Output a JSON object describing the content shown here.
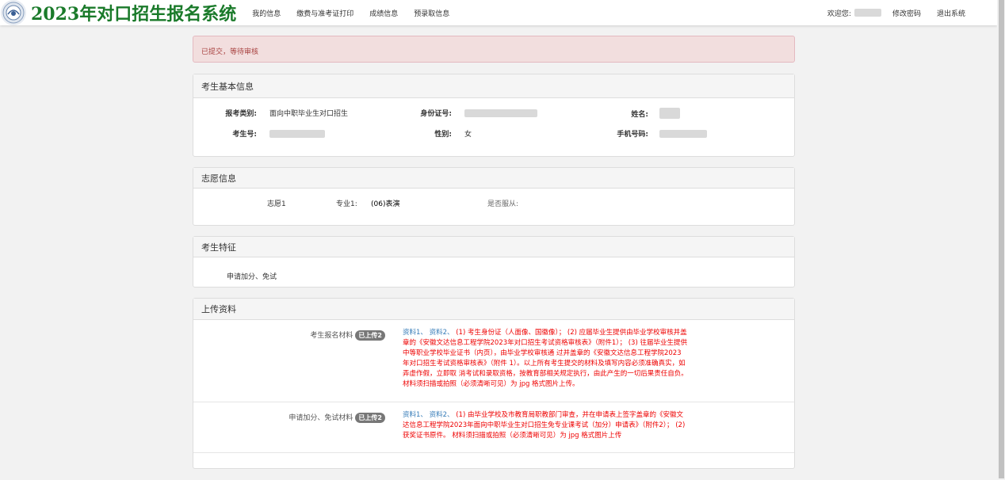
{
  "header": {
    "system_title": "2023年对口招生报名系统",
    "nav": [
      "我的信息",
      "缴费与准考证打印",
      "成绩信息",
      "预录取信息"
    ],
    "welcome": "欢迎您:",
    "change_password": "修改密码",
    "logout": "退出系统"
  },
  "alert": {
    "message": "已提交，等待审核"
  },
  "basic_info": {
    "title": "考生基本信息",
    "category_label": "报考类别:",
    "category_value": "面向中职毕业生对口招生",
    "id_label": "身份证号:",
    "name_label": "姓名:",
    "exam_no_label": "考生号:",
    "gender_label": "性别:",
    "gender_value": "女",
    "phone_label": "手机号码:"
  },
  "volunteer": {
    "title": "志愿信息",
    "choice_label": "志愿1",
    "major_label": "专业1:",
    "major_value": "(06)表演",
    "obey_label": "是否服从:"
  },
  "features": {
    "title": "考生特征",
    "value": "申请加分、免试"
  },
  "uploads": {
    "title": "上传资料",
    "items": [
      {
        "label": "考生报名材料",
        "badge": "已上传2",
        "links": "资料1、 资料2、",
        "desc": " (1) 考生身份证（人面像、国徽像）； (2) 应届毕业生提供由毕业学校审核并盖章的《安徽文达信息工程学院2023年对口招生考试资格审核表》（附件1）； (3) 往届毕业生提供中等职业学校毕业证书（内页），由毕业学校审核通 过并盖章的《安徽文达信息工程学院2023年对口招生考试资格审核表》（附件 1）。以上所有考生提交的材料及填写内容必须准确真实，如弄虚作假，立即取 消考试和录取资格，按教育部相关规定执行，由此产生的一切后果责任自负。材料须扫描或拍照（必须清晰可见）为 jpg 格式图片上传。"
      },
      {
        "label": "申请加分、免试材料",
        "badge": "已上传2",
        "links": "资料1、 资料2、",
        "desc": " (1) 由毕业学校及市教育局职教部门审查，并在申请表上签字盖章的《安徽文达信息工程学院2023年面向中职毕业生对口招生免专业课考试（加分）申请表》（附件2）； (2) 获奖证书原件。 材料须扫描或拍照（必须清晰可见）为 jpg 格式图片上传"
      }
    ]
  }
}
